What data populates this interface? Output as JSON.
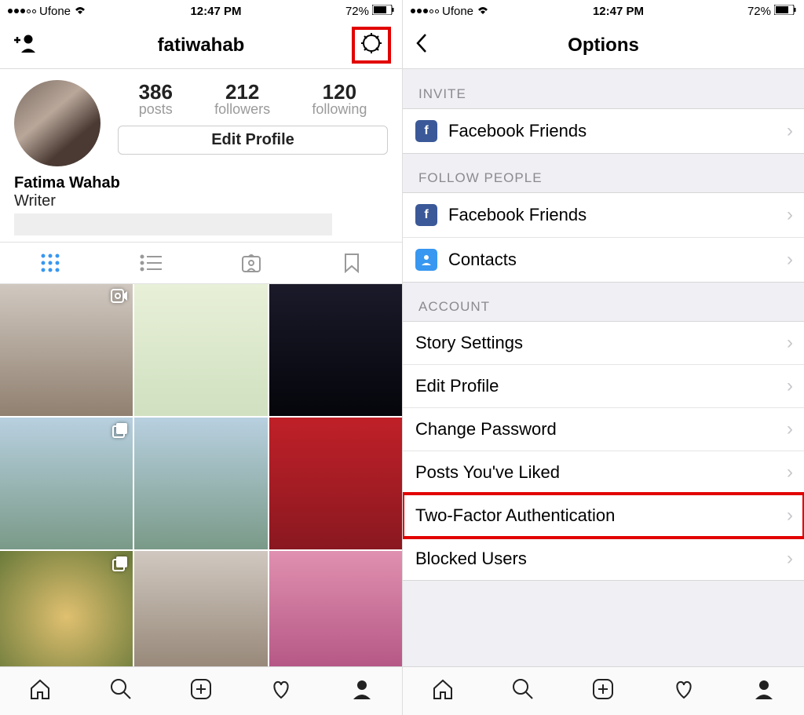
{
  "status": {
    "carrier": "Ufone",
    "time": "12:47 PM",
    "battery": "72%"
  },
  "left": {
    "title": "fatiwahab",
    "stats": {
      "posts": "386",
      "posts_lbl": "posts",
      "followers": "212",
      "followers_lbl": "followers",
      "following": "120",
      "following_lbl": "following"
    },
    "edit_profile": "Edit Profile",
    "bio_name": "Fatima Wahab",
    "bio_line": "Writer"
  },
  "right": {
    "title": "Options",
    "sec_invite": "INVITE",
    "sec_follow": "FOLLOW PEOPLE",
    "sec_account": "ACCOUNT",
    "rows": {
      "fb_friends": "Facebook Friends",
      "contacts": "Contacts",
      "story": "Story Settings",
      "edit_profile": "Edit Profile",
      "change_pw": "Change Password",
      "liked": "Posts You've Liked",
      "twofa": "Two-Factor Authentication",
      "blocked": "Blocked Users"
    }
  }
}
